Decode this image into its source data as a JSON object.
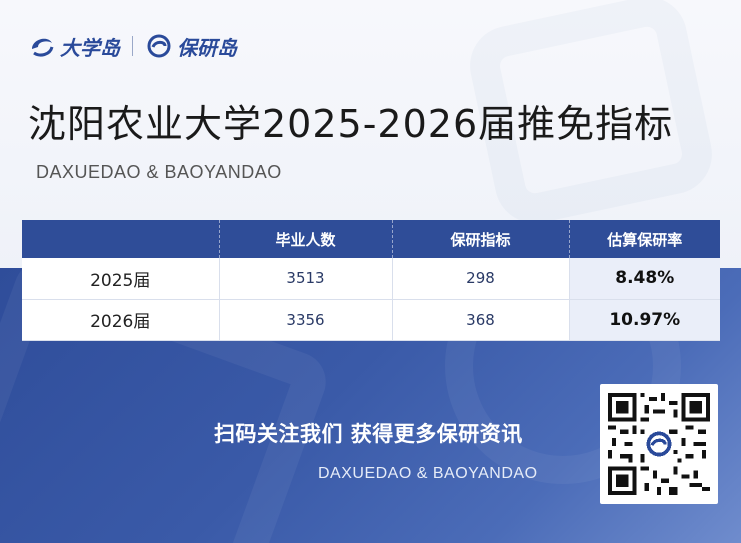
{
  "brand": {
    "logo1": "大学岛",
    "logo2": "保研岛"
  },
  "header": {
    "title": "沈阳农业大学2025-2026届推免指标",
    "subtitle": "DAXUEDAO & BAOYANDAO"
  },
  "table": {
    "headers": [
      "",
      "毕业人数",
      "保研指标",
      "估算保研率"
    ],
    "rows": [
      {
        "year": "2025届",
        "graduates": "3513",
        "quota": "298",
        "rate": "8.48%"
      },
      {
        "year": "2026届",
        "graduates": "3356",
        "quota": "368",
        "rate": "10.97%"
      }
    ]
  },
  "footer": {
    "cta": "扫码关注我们 获得更多保研资讯",
    "sub": "DAXUEDAO & BAOYANDAO"
  },
  "colors": {
    "primary": "#2f4d98",
    "accent_row": "#eaeef9"
  }
}
